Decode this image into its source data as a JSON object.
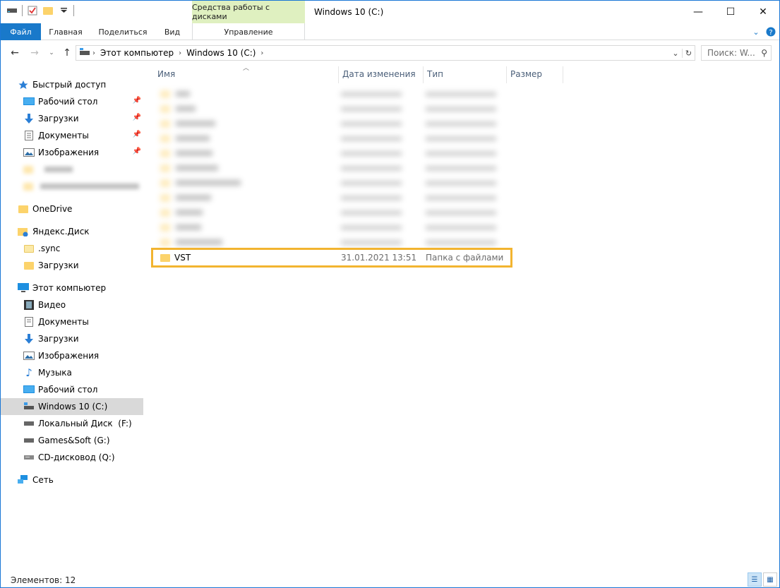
{
  "titlebar": {
    "context_tab": "Средства работы с дисками",
    "window_title": "Windows 10 (C:)",
    "minimize": "—",
    "maximize": "☐",
    "close": "✕"
  },
  "ribbon": {
    "tabs": [
      "Файл",
      "Главная",
      "Поделиться",
      "Вид"
    ],
    "context_label": "Управление"
  },
  "nav": {
    "crumbs": [
      "Этот компьютер",
      "Windows 10 (C:)"
    ],
    "search_placeholder": "Поиск: W..."
  },
  "sidebar": {
    "quick_access": "Быстрый доступ",
    "quick_items": [
      "Рабочий стол",
      "Загрузки",
      "Документы",
      "Изображения"
    ],
    "onedrive": "OneDrive",
    "yandex": "Яндекс.Диск",
    "yandex_items": [
      ".sync",
      "Загрузки"
    ],
    "this_pc": "Этот компьютер",
    "pc_items": [
      "Видео",
      "Документы",
      "Загрузки",
      "Изображения",
      "Музыка",
      "Рабочий стол",
      "Windows 10 (C:)",
      "Локальный Диск  (F:)",
      "Games&Soft (G:)",
      "CD-дисковод (Q:)"
    ],
    "network": "Сеть"
  },
  "columns": {
    "name": "Имя",
    "date": "Дата изменения",
    "type": "Тип",
    "size": "Размер"
  },
  "highlighted_row": {
    "name": "VST",
    "date": "31.01.2021 13:51",
    "type": "Папка с файлами"
  },
  "status": {
    "count": "Элементов: 12"
  },
  "colors": {
    "accent": "#1979ca",
    "highlight": "#f2b430",
    "context": "#dff0c0"
  }
}
